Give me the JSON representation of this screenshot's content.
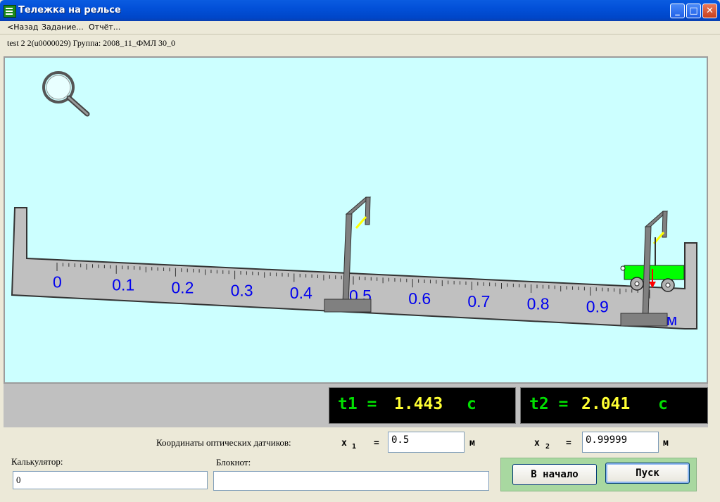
{
  "window": {
    "title": "Тележка на рельсе",
    "controls": [
      "minimize-icon",
      "maximize-icon",
      "close-icon"
    ]
  },
  "menu": {
    "back": "<Назад",
    "task": "Задание...",
    "report": "Отчёт..."
  },
  "info": {
    "session": "test 2 2(u0000029)  Группа: 2008_11_ФМЛ 30_0"
  },
  "scene": {
    "ruler_labels": [
      "0",
      "0.1",
      "0.2",
      "0.3",
      "0.4",
      "0.5",
      "0.6",
      "0.7",
      "0.8",
      "0.9"
    ],
    "ruler_unit": "м",
    "colors": {
      "background": "#ccffff",
      "track": "#c0c0c0",
      "cart": "#00ff00",
      "labels": "#0000ee"
    }
  },
  "timers": {
    "t1": {
      "label": "t1 =",
      "value": "1.443",
      "unit": "c"
    },
    "t2": {
      "label": "t2 =",
      "value": "2.041",
      "unit": "c"
    }
  },
  "sensors": {
    "caption": "Координаты оптических датчиков:",
    "x1_label": "x",
    "x1_sub": "1",
    "x1_eq": "=",
    "x1_value": "0.5",
    "x1_unit": "м",
    "x2_label": "x",
    "x2_sub": "2",
    "x2_eq": "=",
    "x2_value": "0.99999",
    "x2_unit": "м"
  },
  "calculator": {
    "label": "Калькулятор:",
    "value": "0"
  },
  "notepad": {
    "label": "Блокнот:",
    "value": ""
  },
  "buttons": {
    "reset": "В начало",
    "start": "Пуск"
  }
}
